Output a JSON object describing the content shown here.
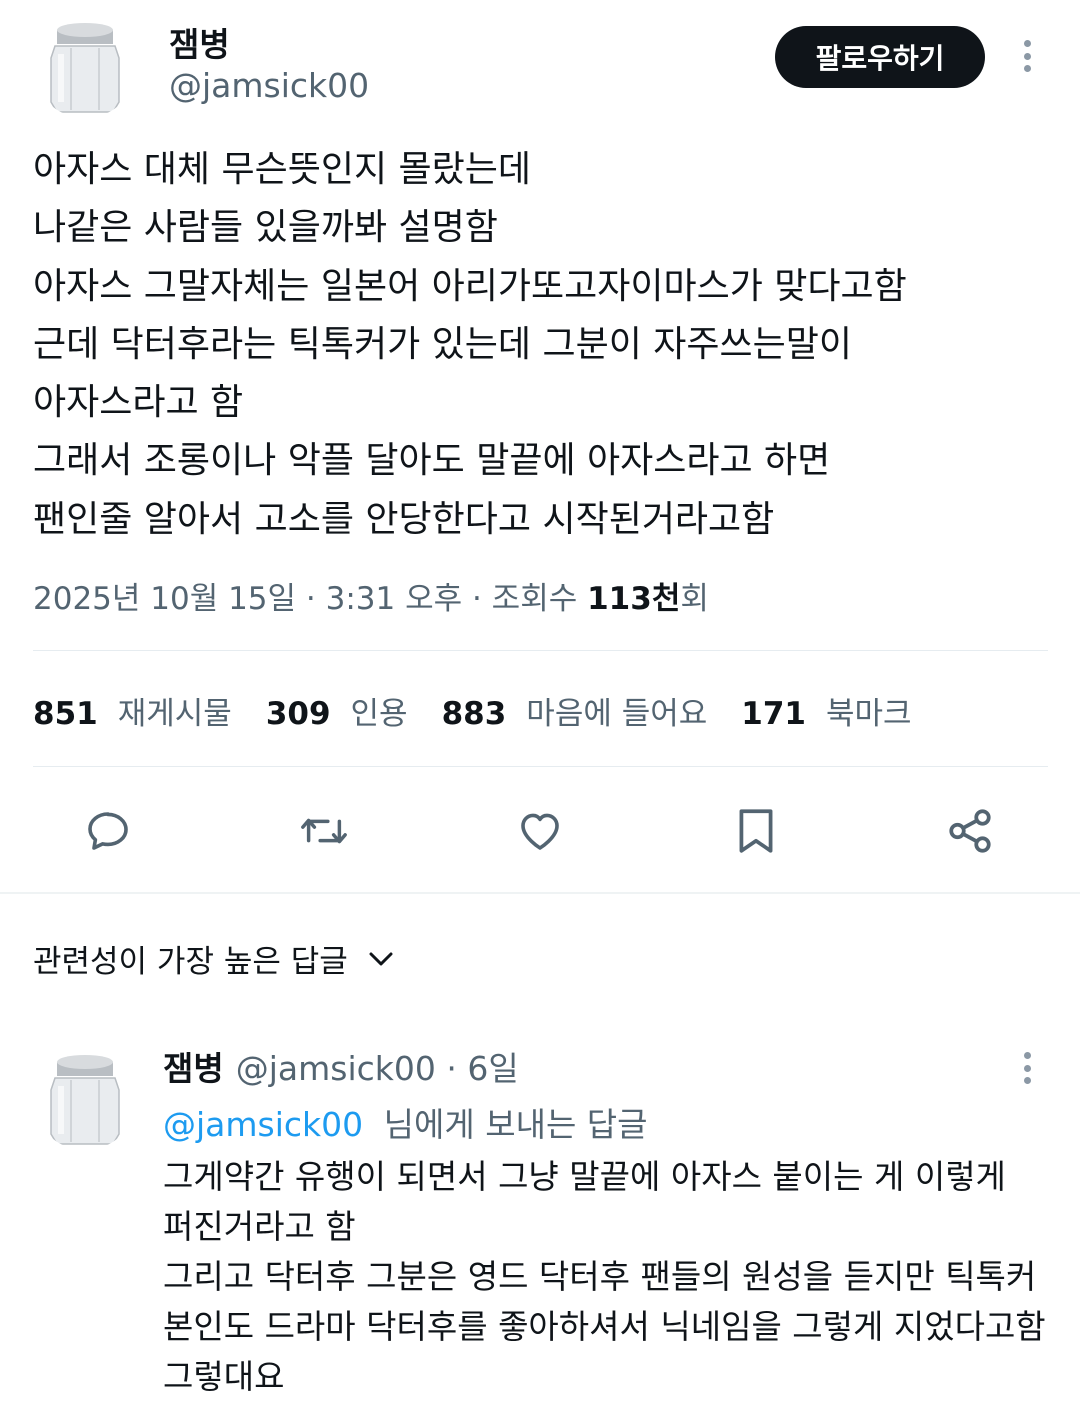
{
  "tweet": {
    "author": {
      "name": "잼병",
      "handle": "@jamsick00"
    },
    "follow_label": "팔로우하기",
    "text_lines": [
      "아자스 대체 무슨뜻인지 몰랐는데",
      "나같은 사람들 있을까봐 설명함",
      "아자스 그말자체는 일본어 아리가또고자이마스가 맞다고함",
      "근데 닥터후라는 틱톡커가 있는데 그분이 자주쓰는말이",
      "아자스라고 함",
      "그래서 조롱이나 악플 달아도 말끝에 아자스라고 하면",
      "팬인줄 알아서 고소를 안당한다고 시작된거라고함"
    ],
    "meta": {
      "date_time": "2025년 10월 15일 · 3:31 오후 · 조회수 ",
      "views_value": "113천",
      "views_suffix": "회"
    },
    "stats": [
      {
        "num": "851",
        "label": "재게시물"
      },
      {
        "num": "309",
        "label": "인용"
      },
      {
        "num": "883",
        "label": "마음에 들어요"
      },
      {
        "num": "171",
        "label": "북마크"
      }
    ],
    "icons": {
      "reply": "reply-icon",
      "retweet": "retweet-icon",
      "like": "heart-icon",
      "bookmark": "bookmark-icon",
      "share": "share-icon",
      "more": "more-icon"
    }
  },
  "sort": {
    "label": "관련성이 가장 높은 답글"
  },
  "reply": {
    "author": {
      "name": "잼병",
      "handle": "@jamsick00",
      "time": " · 6일"
    },
    "replying_to": {
      "mention": "@jamsick00",
      "suffix": "님에게 보내는 답글"
    },
    "text_lines": [
      "그게약간 유행이 되면서 그냥 말끝에 아자스 붙이는 게 이렇게",
      "퍼진거라고 함",
      "그리고 닥터후 그분은 영드 닥터후 팬들의 원성을 듣지만 틱톡커",
      "본인도 드라마 닥터후를 좋아하셔서 닉네임을 그렇게 지었다고함",
      "그렇대요"
    ]
  },
  "colors": {
    "text": "#0f1419",
    "secondary": "#536471",
    "link": "#1d9bf0",
    "button": "#0f1419"
  }
}
